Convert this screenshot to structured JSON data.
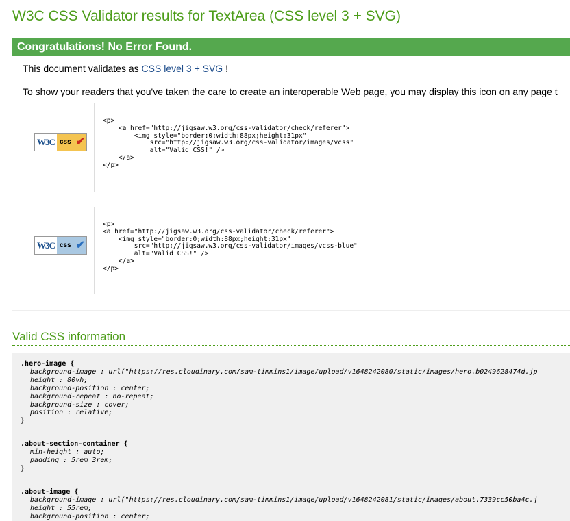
{
  "header": {
    "title": "W3C CSS Validator results for TextArea (CSS level 3 + SVG)"
  },
  "result": {
    "congrats": "Congratulations! No Error Found.",
    "validates_prefix": "This document validates as",
    "validates_link": "CSS level 3 + SVG",
    "validates_suffix": " !",
    "readers_text": "To show your readers that you've taken the care to create an interoperable Web page, you may display this icon on any page t"
  },
  "badges": [
    {
      "w3c_text": "W3C",
      "css_text": "css",
      "check_glyph": "✔",
      "bg_color": "#f4c451",
      "check_color": "#cc2a1c",
      "icon": "valid-css-icon",
      "code": "<p>\n    <a href=\"http://jigsaw.w3.org/css-validator/check/referer\">\n        <img style=\"border:0;width:88px;height:31px\"\n            src=\"http://jigsaw.w3.org/css-validator/images/vcss\"\n            alt=\"Valid CSS!\" />\n    </a>\n</p>"
    },
    {
      "w3c_text": "W3C",
      "css_text": "css",
      "check_glyph": "✔",
      "bg_color": "#a9c8e2",
      "check_color": "#2a6fbf",
      "icon": "valid-css-blue-icon",
      "code": "<p>\n<a href=\"http://jigsaw.w3.org/css-validator/check/referer\">\n    <img style=\"border:0;width:88px;height:31px\"\n        src=\"http://jigsaw.w3.org/css-validator/images/vcss-blue\"\n        alt=\"Valid CSS!\" />\n    </a>\n</p>"
    }
  ],
  "valid_css": {
    "heading": "Valid CSS information",
    "rules": [
      {
        "selector": ".hero-image {",
        "props": [
          {
            "name": "background-image",
            "value": " : url(\"https://res.cloudinary.com/sam-timmins1/image/upload/v1648242080/static/images/hero.b0249628474d.jp"
          },
          {
            "name": "height",
            "value": " : 80vh;"
          },
          {
            "name": "background-position",
            "value": " : center;"
          },
          {
            "name": "background-repeat",
            "value": " : no-repeat;"
          },
          {
            "name": "background-size",
            "value": " : cover;"
          },
          {
            "name": "position",
            "value": " : relative;"
          }
        ],
        "close": "}"
      },
      {
        "selector": ".about-section-container {",
        "props": [
          {
            "name": "min-height",
            "value": " : auto;"
          },
          {
            "name": "padding",
            "value": " : 5rem 3rem;"
          }
        ],
        "close": "}"
      },
      {
        "selector": ".about-image {",
        "props": [
          {
            "name": "background-image",
            "value": " : url(\"https://res.cloudinary.com/sam-timmins1/image/upload/v1648242081/static/images/about.7339cc50ba4c.j"
          },
          {
            "name": "height",
            "value": " : 55rem;"
          },
          {
            "name": "background-position",
            "value": " : center;"
          }
        ],
        "close": ""
      }
    ]
  }
}
